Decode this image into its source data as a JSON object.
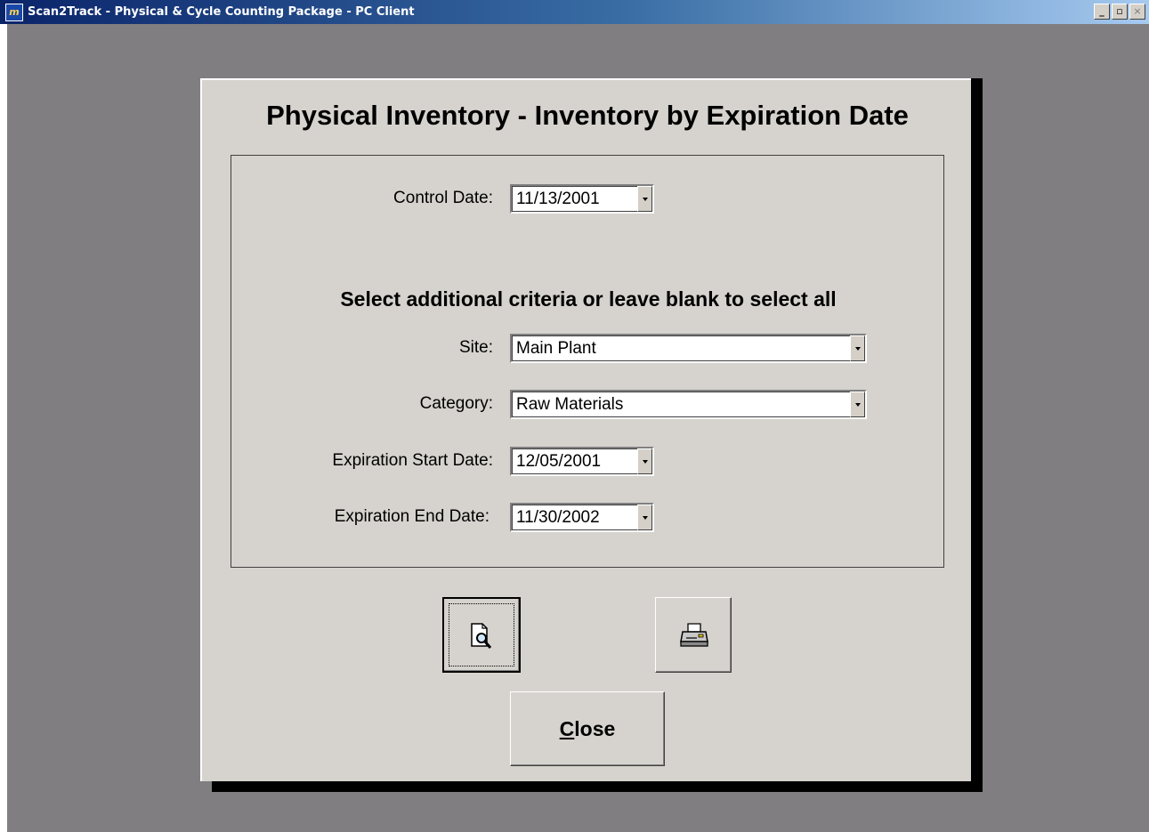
{
  "window": {
    "app_icon_text": "m",
    "title": "Scan2Track - Physical & Cycle Counting Package - PC Client",
    "minimize_glyph": "_",
    "restore_glyph": "▫",
    "close_glyph": "×"
  },
  "form": {
    "title": "Physical Inventory - Inventory by Expiration Date",
    "control_date": {
      "label": "Control Date:",
      "value": "11/13/2001"
    },
    "criteria_heading": "Select additional criteria or leave blank to select all",
    "site": {
      "label": "Site:",
      "value": "Main Plant"
    },
    "category": {
      "label": "Category:",
      "value": "Raw Materials"
    },
    "expiration_start": {
      "label": "Expiration Start Date:",
      "value": "12/05/2001"
    },
    "expiration_end": {
      "label": "Expiration End Date:",
      "value": "11/30/2002"
    }
  },
  "buttons": {
    "preview_icon": "print-preview-icon",
    "print_icon": "printer-icon",
    "close_mnemonic": "C",
    "close_rest": "lose"
  }
}
